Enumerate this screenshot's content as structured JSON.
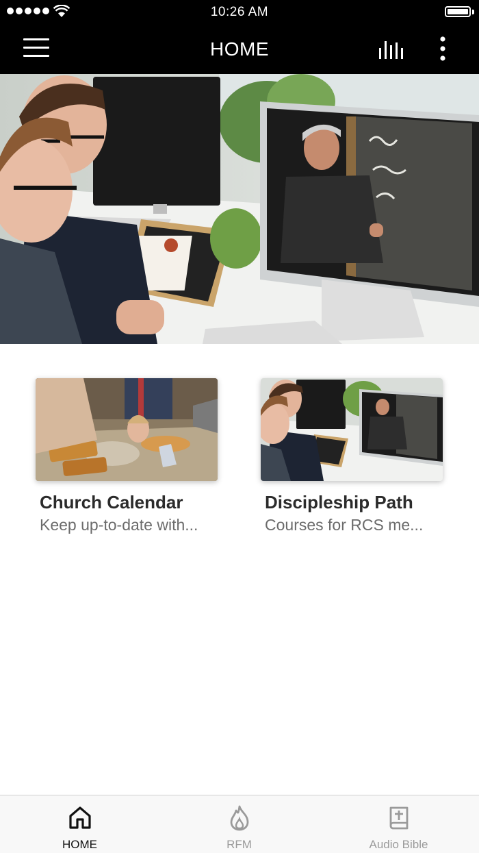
{
  "status_bar": {
    "time": "10:26 AM",
    "signal_icon": "signal-dots-icon",
    "wifi_icon": "wifi-icon",
    "battery_icon": "battery-icon",
    "battery_level": 1.0
  },
  "nav": {
    "title": "HOME",
    "menu_icon": "hamburger-menu-icon",
    "audio_icon": "audio-bars-icon",
    "more_icon": "more-vertical-icon"
  },
  "hero": {
    "image": "men-watching-lecture-on-computer-photo",
    "slides": 2,
    "active_slide": 1
  },
  "cards": [
    {
      "title": "Church Calendar",
      "subtitle": "Keep up-to-date with...",
      "image": "family-meal-photo"
    },
    {
      "title": "Discipleship Path",
      "subtitle": "Courses for RCS me...",
      "image": "men-watching-lecture-on-computer-photo"
    }
  ],
  "tabs": [
    {
      "label": "HOME",
      "icon": "home-icon",
      "active": true
    },
    {
      "label": "RFM",
      "icon": "flame-icon",
      "active": false
    },
    {
      "label": "Audio Bible",
      "icon": "bible-icon",
      "active": false
    }
  ],
  "colors": {
    "bar_background": "#000000",
    "active_tab": "#111111",
    "inactive_tab": "#9a9a9a",
    "card_title": "#2b2b2b",
    "card_subtitle": "#6b6b6b"
  }
}
